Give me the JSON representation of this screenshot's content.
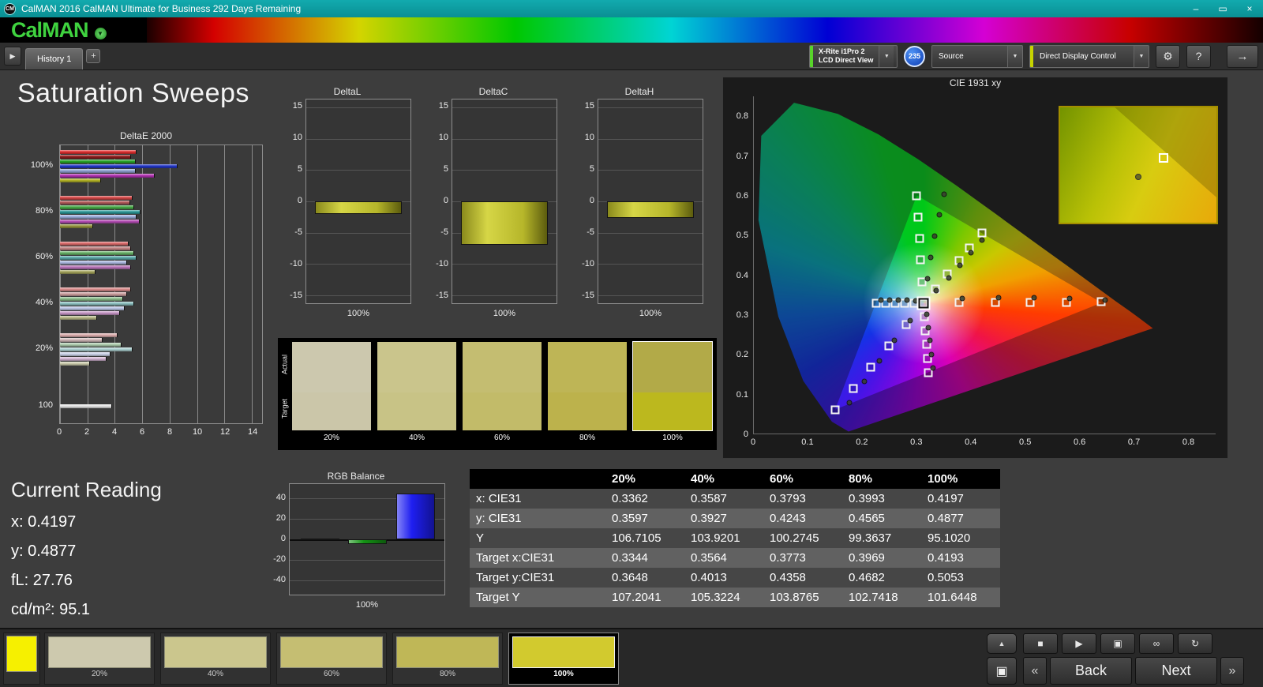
{
  "window": {
    "icon_text": "CM",
    "title": "CalMAN 2016 CalMAN Ultimate for Business 292 Days Remaining",
    "minimize": "–",
    "restore": "▭",
    "close": "×"
  },
  "brand": {
    "logo": "CalMAN",
    "caret": "▼"
  },
  "tabbar": {
    "panel_toggle": "▶",
    "tab": "History 1",
    "add_tab": "+",
    "meter": {
      "line1": "X-Rite i1Pro 2",
      "line2": "LCD Direct View",
      "arrow": "▼"
    },
    "badge": "235",
    "source": {
      "label": "Source",
      "arrow": "▼"
    },
    "display_control": {
      "label": "Direct Display Control",
      "arrow": "▼"
    },
    "settings_icon": "⚙",
    "help_icon": "?",
    "advance_icon": "→"
  },
  "page_title": "Saturation Sweeps",
  "deltae": {
    "title": "DeltaE 2000",
    "x_max": 14,
    "x_ticks": [
      0,
      2,
      4,
      6,
      8,
      10,
      12,
      14
    ],
    "groups": [
      {
        "label": "100%",
        "values": [
          5.6,
          5.2,
          5.5,
          8.6,
          5.5,
          6.9,
          3.0
        ],
        "colors": [
          "#e03030",
          "#8f1d1d",
          "#28a428",
          "#2236c8",
          "#8ea2d2",
          "#b232b2",
          "#b4b428"
        ]
      },
      {
        "label": "80%",
        "values": [
          5.3,
          5.1,
          5.4,
          5.9,
          5.6,
          5.8,
          2.4
        ],
        "colors": [
          "#d84848",
          "#b25a5a",
          "#46aa46",
          "#2e9898",
          "#9caede",
          "#b44eb4",
          "#94943e"
        ]
      },
      {
        "label": "60%",
        "values": [
          5.0,
          5.2,
          5.4,
          5.6,
          4.9,
          5.2,
          2.6
        ],
        "colors": [
          "#da6a6a",
          "#c28484",
          "#66b066",
          "#5aa8a8",
          "#aab6de",
          "#ba74ba",
          "#a4a45c"
        ]
      },
      {
        "label": "40%",
        "values": [
          5.2,
          4.9,
          4.6,
          5.4,
          4.7,
          4.4,
          2.7
        ],
        "colors": [
          "#da8c8c",
          "#cc9e9e",
          "#8cbe8c",
          "#8cc0c0",
          "#bcc6e6",
          "#c696c6",
          "#b6b686"
        ]
      },
      {
        "label": "20%",
        "values": [
          4.2,
          3.1,
          4.5,
          5.3,
          3.7,
          3.4,
          2.2
        ],
        "colors": [
          "#dcaeae",
          "#d4bcbc",
          "#aeccae",
          "#aed2d2",
          "#ccd4ea",
          "#d4b6d4",
          "#ccccae"
        ]
      },
      {
        "label": "100",
        "values": [
          3.8
        ],
        "colors": [
          "#e6e6e6"
        ]
      }
    ]
  },
  "delta_charts": {
    "axis_ticks": [
      15,
      10,
      5,
      0,
      -5,
      -10,
      -15
    ],
    "axis_max": 15,
    "items": [
      {
        "title": "DeltaL",
        "value": -2.0,
        "x_label": "100%"
      },
      {
        "title": "DeltaC",
        "value": -7.0,
        "x_label": "100%"
      },
      {
        "title": "DeltaH",
        "value": -2.6,
        "x_label": "100%"
      }
    ]
  },
  "saturation_strip": {
    "row_labels": [
      "Actual",
      "Target"
    ],
    "swatches": [
      {
        "label": "20%",
        "actual": "#ccc8ae",
        "target": "#cbc6a9",
        "selected": false
      },
      {
        "label": "40%",
        "actual": "#cac58c",
        "target": "#c8c386",
        "selected": false
      },
      {
        "label": "60%",
        "actual": "#c4bd71",
        "target": "#c2bb69",
        "selected": false
      },
      {
        "label": "80%",
        "actual": "#beb556",
        "target": "#bcb24c",
        "selected": false
      },
      {
        "label": "100%",
        "actual": "#b2aa48",
        "target": "#bcb81e",
        "selected": true
      }
    ]
  },
  "cie": {
    "title": "CIE 1931 xy",
    "axis_max": 0.85,
    "x_ticks": [
      0,
      0.1,
      0.2,
      0.3,
      0.4,
      0.5,
      0.6,
      0.7,
      0.8
    ],
    "y_ticks": [
      0.8,
      0.7,
      0.6,
      0.5,
      0.4,
      0.3,
      0.2,
      0.1,
      0
    ],
    "gamut_triangle": [
      [
        0.64,
        0.33
      ],
      [
        0.3,
        0.6
      ],
      [
        0.15,
        0.06
      ]
    ],
    "white_point": [
      0.3127,
      0.329
    ],
    "targets": [
      [
        0.3127,
        0.329
      ],
      [
        0.378,
        0.33
      ],
      [
        0.444,
        0.33
      ],
      [
        0.509,
        0.331
      ],
      [
        0.575,
        0.331
      ],
      [
        0.64,
        0.332
      ],
      [
        0.31,
        0.383
      ],
      [
        0.307,
        0.437
      ],
      [
        0.305,
        0.492
      ],
      [
        0.302,
        0.546
      ],
      [
        0.3,
        0.6
      ],
      [
        0.28,
        0.275
      ],
      [
        0.248,
        0.221
      ],
      [
        0.215,
        0.167
      ],
      [
        0.183,
        0.114
      ],
      [
        0.15,
        0.06
      ],
      [
        0.3344,
        0.3648
      ],
      [
        0.3564,
        0.4013
      ],
      [
        0.3773,
        0.4358
      ],
      [
        0.3969,
        0.4682
      ],
      [
        0.4193,
        0.5053
      ],
      [
        0.295,
        0.329
      ],
      [
        0.277,
        0.329
      ],
      [
        0.26,
        0.329
      ],
      [
        0.242,
        0.329
      ],
      [
        0.225,
        0.329
      ],
      [
        0.314,
        0.294
      ],
      [
        0.316,
        0.259
      ],
      [
        0.318,
        0.224
      ],
      [
        0.319,
        0.189
      ],
      [
        0.321,
        0.154
      ]
    ],
    "measurements": [
      [
        0.3362,
        0.3597
      ],
      [
        0.3587,
        0.3927
      ],
      [
        0.3793,
        0.4243
      ],
      [
        0.3993,
        0.4565
      ],
      [
        0.4197,
        0.4877
      ],
      [
        0.383,
        0.34
      ],
      [
        0.45,
        0.342
      ],
      [
        0.516,
        0.342
      ],
      [
        0.581,
        0.34
      ],
      [
        0.646,
        0.336
      ],
      [
        0.32,
        0.39
      ],
      [
        0.326,
        0.444
      ],
      [
        0.333,
        0.498
      ],
      [
        0.341,
        0.552
      ],
      [
        0.35,
        0.604
      ],
      [
        0.287,
        0.284
      ],
      [
        0.259,
        0.234
      ],
      [
        0.231,
        0.183
      ],
      [
        0.203,
        0.131
      ],
      [
        0.176,
        0.078
      ],
      [
        0.298,
        0.335
      ],
      [
        0.282,
        0.336
      ],
      [
        0.266,
        0.336
      ],
      [
        0.25,
        0.336
      ],
      [
        0.234,
        0.336
      ],
      [
        0.318,
        0.3
      ],
      [
        0.321,
        0.267
      ],
      [
        0.324,
        0.234
      ],
      [
        0.327,
        0.2
      ],
      [
        0.33,
        0.166
      ]
    ],
    "inset": {
      "square": [
        0.66,
        0.44
      ],
      "dot": [
        0.5,
        0.6
      ]
    }
  },
  "current_reading": {
    "title": "Current Reading",
    "lines": [
      "x: 0.4197",
      "y: 0.4877",
      "fL: 27.76",
      "cd/m²: 95.1"
    ]
  },
  "rgb_balance": {
    "title": "RGB Balance",
    "axis_ticks": [
      40,
      20,
      0,
      -20,
      -40
    ],
    "axis_max": 50,
    "bars": [
      {
        "name": "red",
        "color": "#c01414",
        "value": 0.4
      },
      {
        "name": "green",
        "color": "#159415",
        "value": -5
      },
      {
        "name": "blue",
        "color": "#1e1ef0",
        "value": 45
      }
    ],
    "x_label": "100%"
  },
  "table": {
    "columns": [
      "20%",
      "40%",
      "60%",
      "80%",
      "100%"
    ],
    "rows": [
      {
        "label": "x: CIE31",
        "values": [
          "0.3362",
          "0.3587",
          "0.3793",
          "0.3993",
          "0.4197"
        ]
      },
      {
        "label": "y: CIE31",
        "values": [
          "0.3597",
          "0.3927",
          "0.4243",
          "0.4565",
          "0.4877"
        ]
      },
      {
        "label": "Y",
        "values": [
          "106.7105",
          "103.9201",
          "100.2745",
          "99.3637",
          "95.1020"
        ]
      },
      {
        "label": "Target x:CIE31",
        "values": [
          "0.3344",
          "0.3564",
          "0.3773",
          "0.3969",
          "0.4193"
        ]
      },
      {
        "label": "Target y:CIE31",
        "values": [
          "0.3648",
          "0.4013",
          "0.4358",
          "0.4682",
          "0.5053"
        ]
      },
      {
        "label": "Target Y",
        "values": [
          "107.2041",
          "105.3224",
          "103.8765",
          "102.7418",
          "101.6448"
        ]
      }
    ]
  },
  "bottom": {
    "current_color": "#f6f000",
    "selected": "100%",
    "swatch_buttons": [
      {
        "label": "20%",
        "color": "#cdc9ae"
      },
      {
        "label": "40%",
        "color": "#cbc68d"
      },
      {
        "label": "60%",
        "color": "#c5be72"
      },
      {
        "label": "80%",
        "color": "#bfb757"
      },
      {
        "label": "100%",
        "color": "#d2ca2e"
      }
    ],
    "transport": [
      {
        "name": "stop-icon",
        "glyph": "■"
      },
      {
        "name": "play-icon",
        "glyph": "▶"
      },
      {
        "name": "capture-icon",
        "glyph": "▣"
      },
      {
        "name": "continuous-icon",
        "glyph": "∞"
      },
      {
        "name": "refresh-icon",
        "glyph": "↻"
      }
    ],
    "eject_icon": "▲",
    "stop_large_icon": "▣",
    "back_prev_icon": "«",
    "back": "Back",
    "next": "Next",
    "next_icon": "»"
  }
}
